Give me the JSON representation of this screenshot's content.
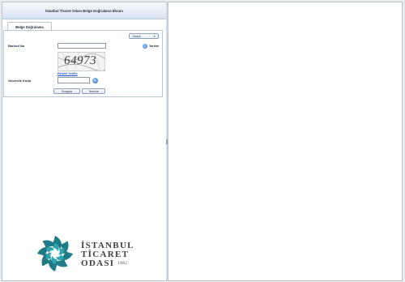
{
  "header": {
    "title": "İstanbul Ticaret Odası Belge Doğrulama Ekranı"
  },
  "tab": {
    "label": "Belge Doğrulama"
  },
  "language_select": {
    "value": "Türkçe"
  },
  "help": {
    "label": "Yardım"
  },
  "form": {
    "barcode_label": "Barkod No",
    "barcode_value": "",
    "colon": ":",
    "captcha_text": "64973",
    "refresh_label": "Resmi Yenile",
    "security_code_label": "Güvenlik Kodu",
    "security_code_value": ""
  },
  "buttons": {
    "query": "Sorgula",
    "clear": "Temizle"
  },
  "logo": {
    "line1": "İSTANBUL",
    "line2": "TİCARET",
    "line3": "ODASI",
    "year": "1882"
  },
  "colors": {
    "accent_link": "#1e56c8",
    "logo_teal": "#1f7c86",
    "logo_text": "#3d4247"
  }
}
